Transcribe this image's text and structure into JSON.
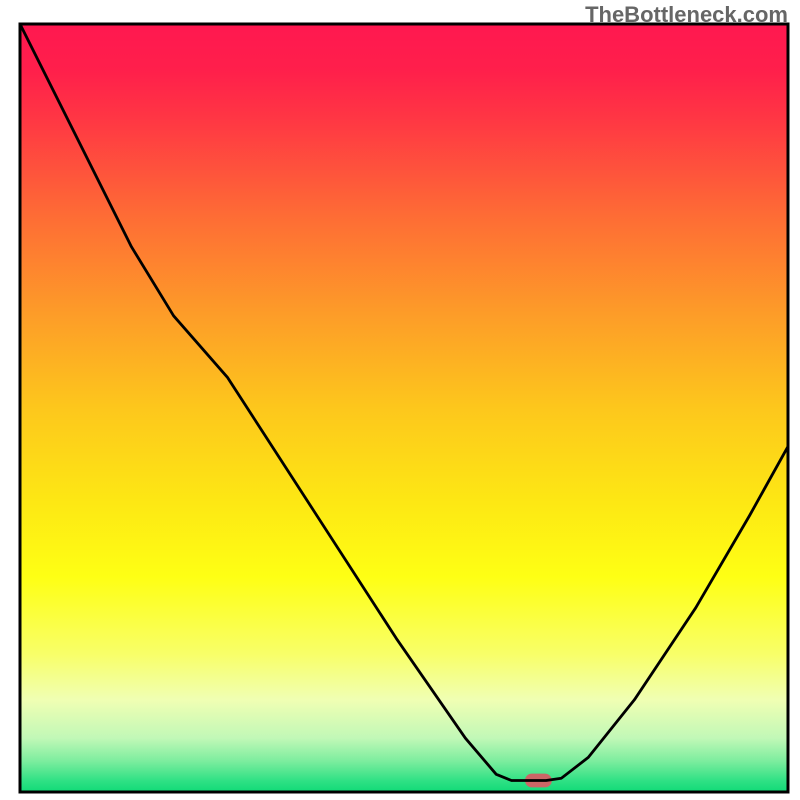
{
  "watermark": "TheBottleneck.com",
  "chart_data": {
    "type": "line",
    "title": "",
    "xlabel": "",
    "ylabel": "",
    "xlim": [
      0,
      100
    ],
    "ylim": [
      0,
      100
    ],
    "background_gradient": {
      "stops": [
        {
          "offset": 0.0,
          "color": "#ff1850"
        },
        {
          "offset": 0.06,
          "color": "#ff1f4b"
        },
        {
          "offset": 0.12,
          "color": "#ff3544"
        },
        {
          "offset": 0.25,
          "color": "#fe6c35"
        },
        {
          "offset": 0.38,
          "color": "#fd9d28"
        },
        {
          "offset": 0.5,
          "color": "#fdc71c"
        },
        {
          "offset": 0.62,
          "color": "#fde714"
        },
        {
          "offset": 0.72,
          "color": "#feff14"
        },
        {
          "offset": 0.82,
          "color": "#f8ff68"
        },
        {
          "offset": 0.88,
          "color": "#f0ffb3"
        },
        {
          "offset": 0.93,
          "color": "#c1f8b7"
        },
        {
          "offset": 0.96,
          "color": "#7ced9e"
        },
        {
          "offset": 0.985,
          "color": "#30e185"
        },
        {
          "offset": 1.0,
          "color": "#10da77"
        }
      ]
    },
    "series": [
      {
        "name": "bottleneck-curve",
        "type": "line",
        "color": "#000000",
        "points": [
          {
            "x": 0.0,
            "y": 100.0
          },
          {
            "x": 7.0,
            "y": 86.0
          },
          {
            "x": 14.5,
            "y": 71.0
          },
          {
            "x": 20.0,
            "y": 62.0
          },
          {
            "x": 27.0,
            "y": 54.0
          },
          {
            "x": 38.0,
            "y": 37.0
          },
          {
            "x": 49.0,
            "y": 20.0
          },
          {
            "x": 58.0,
            "y": 7.0
          },
          {
            "x": 62.0,
            "y": 2.3
          },
          {
            "x": 64.0,
            "y": 1.5
          },
          {
            "x": 68.5,
            "y": 1.5
          },
          {
            "x": 70.5,
            "y": 1.8
          },
          {
            "x": 74.0,
            "y": 4.5
          },
          {
            "x": 80.0,
            "y": 12.0
          },
          {
            "x": 88.0,
            "y": 24.0
          },
          {
            "x": 95.0,
            "y": 36.0
          },
          {
            "x": 100.0,
            "y": 45.0
          }
        ]
      }
    ],
    "marker": {
      "x": 67.5,
      "y": 1.5,
      "width": 3.5,
      "height": 1.8,
      "color": "#cc6666"
    },
    "border": {
      "color": "#000000",
      "width": 3
    }
  }
}
